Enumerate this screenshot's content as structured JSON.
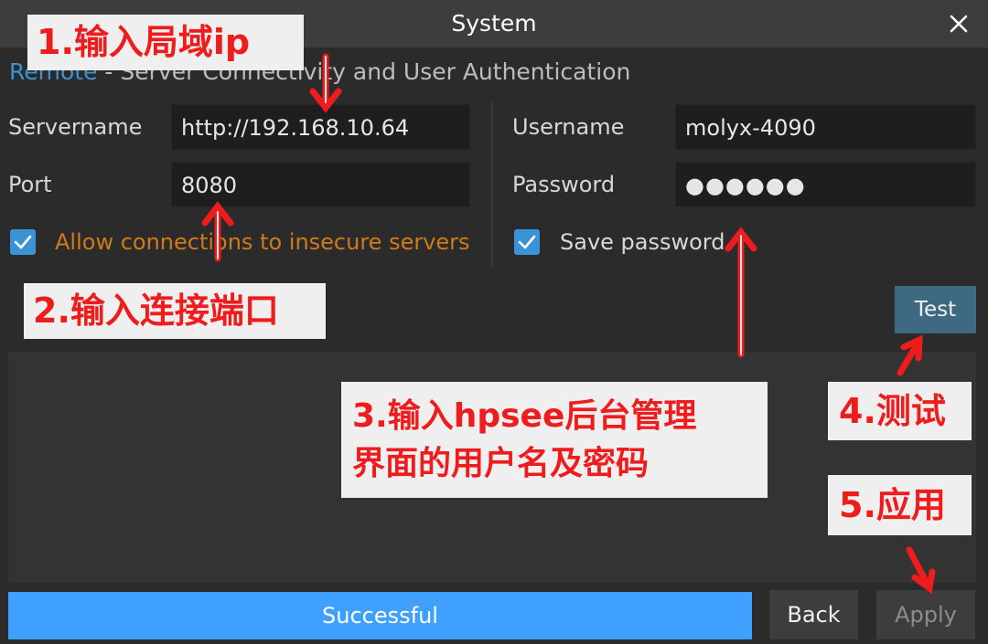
{
  "window": {
    "title": "System"
  },
  "breadcrumb": {
    "parent": "Remote",
    "separator": " - ",
    "current": "Server Connectivity and User Authentication"
  },
  "form": {
    "servername_label": "Servername",
    "servername_value": "http://192.168.10.64",
    "port_label": "Port",
    "port_value": "8080",
    "insecure_label": "Allow connections to insecure servers",
    "username_label": "Username",
    "username_value": "molyx-4090",
    "password_label": "Password",
    "password_value": "●●●●●●",
    "save_password_label": "Save password"
  },
  "buttons": {
    "test": "Test",
    "back": "Back",
    "apply": "Apply"
  },
  "status": {
    "text": "Successful"
  },
  "annotations": {
    "step1": "1.输入局域ip",
    "step2": "2.输入连接端口",
    "step3_line1": "3.输入hpsee后台管理",
    "step3_line2": "界面的用户名及密码",
    "step4": "4.测试",
    "step5": "5.应用"
  },
  "colors": {
    "accent": "#3a93d4",
    "status_bar": "#3fa0ff",
    "warning_text": "#d07a1a",
    "annotation_text": "#ee1c1c",
    "annotation_bg": "#efefef"
  }
}
